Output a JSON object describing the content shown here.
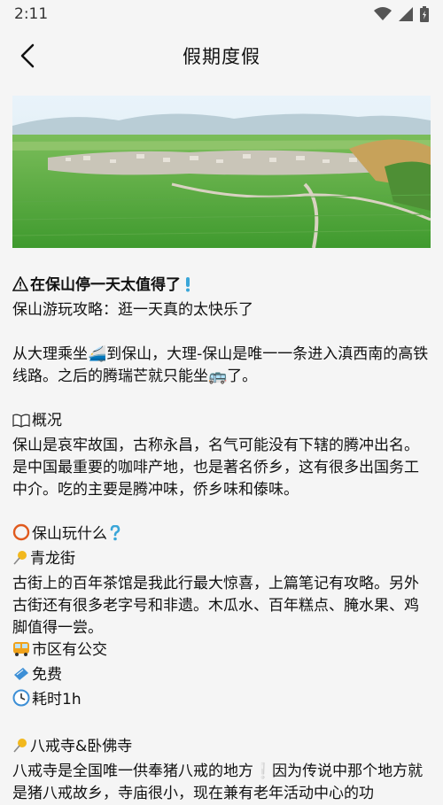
{
  "status_bar": {
    "time": "2:11"
  },
  "nav": {
    "title": "假期度假"
  },
  "article": {
    "headline": "在保山停一天太值得了",
    "subtitle": "保山游玩攻略：逛一天真的太快乐了",
    "intro": "从大理乘坐🚄到保山，大理-保山是唯一一条进入滇西南的高铁线路。之后的腾瑞芒就只能坐🚌了。",
    "overview_heading": "概况",
    "overview_text": "保山是哀牢故国，古称永昌，名气可能没有下辖的腾冲出名。是中国最重要的咖啡产地，也是著名侨乡，这有很多出国务工中介。吃的主要是腾冲味，侨乡味和傣味。",
    "what_heading": "保山玩什么",
    "spot1_name": "青龙街",
    "spot1_text": "古街上的百年茶馆是我此行最大惊喜，上篇笔记有攻略。另外古街还有很多老字号和非遗。木瓜水、百年糕点、腌水果、鸡脚值得一尝。",
    "spot1_bus": "市区有公交",
    "spot1_ticket": "免费",
    "spot1_time": "耗时1h",
    "spot2_name": "八戒寺&卧佛寺",
    "spot2_text": "八戒寺是全国唯一供奉猪八戒的地方❕因为传说中那个地方就是猪八戒故乡，寺庙很小，现在兼有老年活动中心的功"
  }
}
